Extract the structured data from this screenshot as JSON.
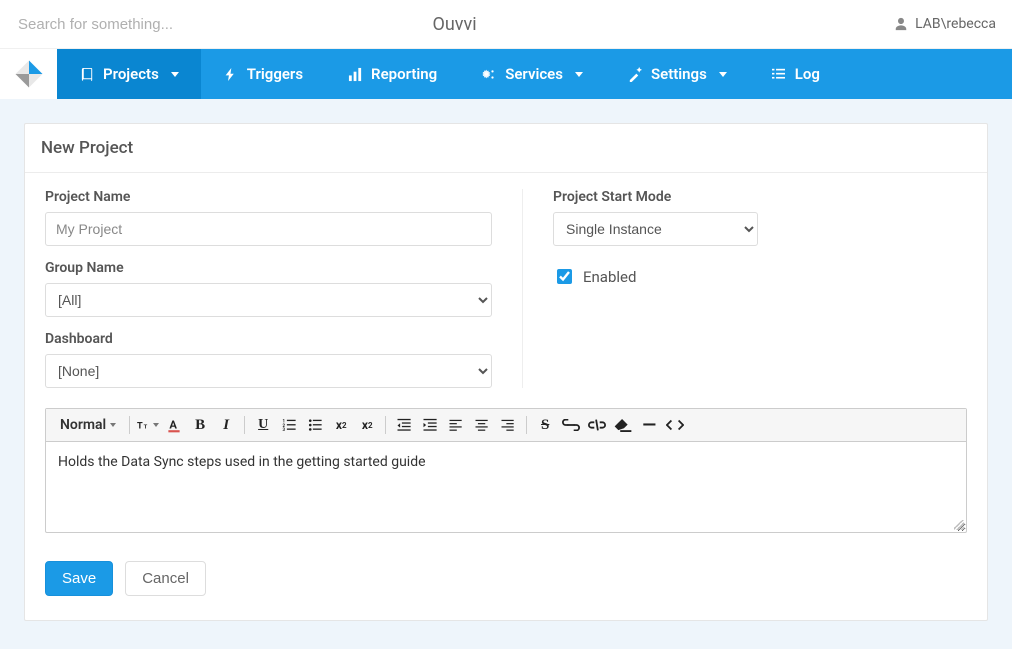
{
  "header": {
    "search_placeholder": "Search for something...",
    "app_title": "Ouvvi",
    "user_label": "LAB\\rebecca"
  },
  "nav": {
    "items": [
      {
        "label": "Projects",
        "icon": "book",
        "active": true,
        "dropdown": true
      },
      {
        "label": "Triggers",
        "icon": "bolt",
        "active": false,
        "dropdown": false
      },
      {
        "label": "Reporting",
        "icon": "bar-chart",
        "active": false,
        "dropdown": false
      },
      {
        "label": "Services",
        "icon": "cogs",
        "active": false,
        "dropdown": true
      },
      {
        "label": "Settings",
        "icon": "magic",
        "active": false,
        "dropdown": true
      },
      {
        "label": "Log",
        "icon": "list",
        "active": false,
        "dropdown": false
      }
    ]
  },
  "page": {
    "title": "New Project",
    "form": {
      "project_name_label": "Project Name",
      "project_name_value": "My Project",
      "group_name_label": "Group Name",
      "group_name_value": "[All]",
      "dashboard_label": "Dashboard",
      "dashboard_value": "[None]",
      "start_mode_label": "Project Start Mode",
      "start_mode_value": "Single Instance",
      "enabled_label": "Enabled",
      "enabled_checked": true
    },
    "editor": {
      "format_label": "Normal",
      "content": "Holds the Data Sync steps used in the getting started guide"
    },
    "buttons": {
      "save": "Save",
      "cancel": "Cancel"
    }
  }
}
